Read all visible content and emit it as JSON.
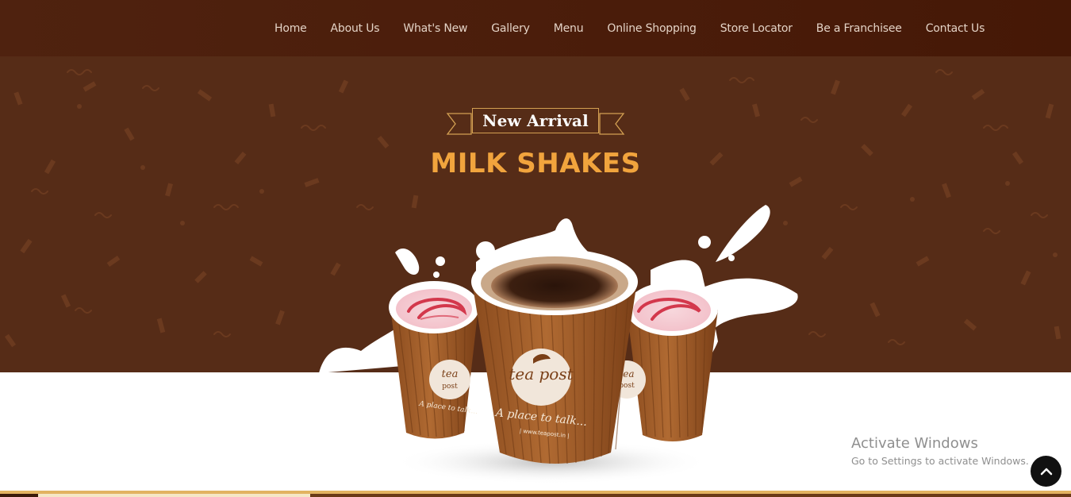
{
  "nav": {
    "items": [
      {
        "label": "Home"
      },
      {
        "label": "About Us"
      },
      {
        "label": "What's New"
      },
      {
        "label": "Gallery"
      },
      {
        "label": "Menu"
      },
      {
        "label": "Online Shopping"
      },
      {
        "label": "Store Locator"
      },
      {
        "label": "Be a Franchisee"
      },
      {
        "label": "Contact Us"
      }
    ]
  },
  "hero": {
    "badge": "New Arrival",
    "title": "MILK SHAKES",
    "cup_brand": "tea post",
    "cup_tagline": "A place to talk...",
    "cup_url": "| www.teapost.in |"
  },
  "watermark": {
    "line1": "Activate Windows",
    "line2": "Go to Settings to activate Windows."
  },
  "colors": {
    "nav_bg": "#4a1c0a",
    "hero_bg": "#562c17",
    "title": "#f1a43d",
    "badge_border": "#d3a052"
  },
  "icons": {
    "scroll_top": "chevron-up-icon"
  }
}
